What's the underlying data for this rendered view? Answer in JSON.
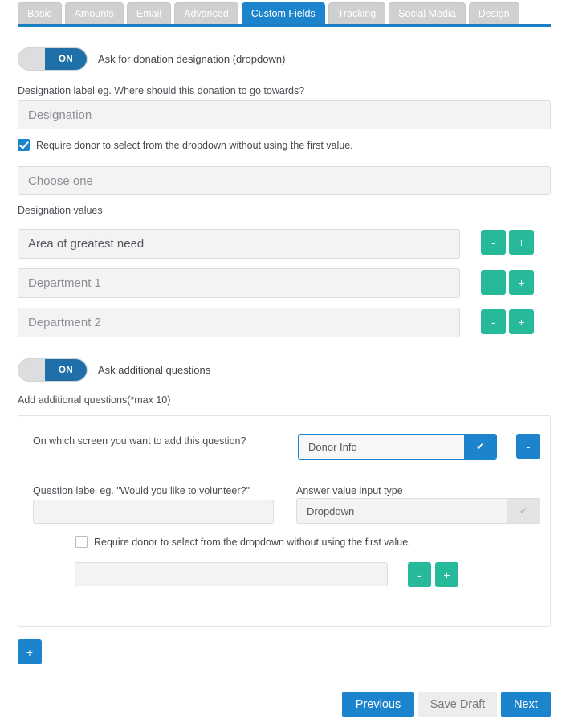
{
  "tabs": [
    {
      "label": "Basic",
      "active": false
    },
    {
      "label": "Amounts",
      "active": false
    },
    {
      "label": "Email",
      "active": false
    },
    {
      "label": "Advanced",
      "active": false
    },
    {
      "label": "Custom Fields",
      "active": true
    },
    {
      "label": "Tracking",
      "active": false
    },
    {
      "label": "Social Media",
      "active": false
    },
    {
      "label": "Design",
      "active": false
    }
  ],
  "designation": {
    "toggle_state": "ON",
    "toggle_label": "Ask for donation designation (dropdown)",
    "label_caption": "Designation label eg. Where should this donation to go towards?",
    "label_value": "Designation",
    "require_checkbox_label": "Require donor to select from the dropdown without using the first value.",
    "require_checked": true,
    "first_value": "Choose one",
    "values_caption": "Designation values",
    "values": [
      {
        "text": "Area of greatest need",
        "is_value": true
      },
      {
        "text": "Department 1",
        "is_value": false
      },
      {
        "text": "Department 2",
        "is_value": false
      }
    ],
    "minus_label": "-",
    "plus_label": "+"
  },
  "questions": {
    "toggle_state": "ON",
    "toggle_label": "Ask additional questions",
    "section_caption": "Add additional questions(*max 10)",
    "screen_label": "On which screen you want to add this question?",
    "screen_value": "Donor Info",
    "chevron": "✔",
    "remove_label": "-",
    "question_label_caption": "Question label eg. \"Would you like to volunteer?\"",
    "question_label_value": "",
    "answer_type_caption": "Answer value input type",
    "answer_type_value": "Dropdown",
    "answer_chevron": "✔",
    "require_checkbox_label": "Require donor to select from the dropdown without using the first value.",
    "require_checked": false,
    "option_value": "",
    "minus_label": "-",
    "plus_label": "+",
    "add_question_label": "+"
  },
  "footer": {
    "previous": "Previous",
    "save_draft": "Save Draft",
    "next": "Next"
  },
  "colors": {
    "accent_blue": "#1b84cc",
    "toggle_blue": "#1f6fa8",
    "teal": "#26b99a",
    "tab_grey": "#cfd0d2"
  }
}
